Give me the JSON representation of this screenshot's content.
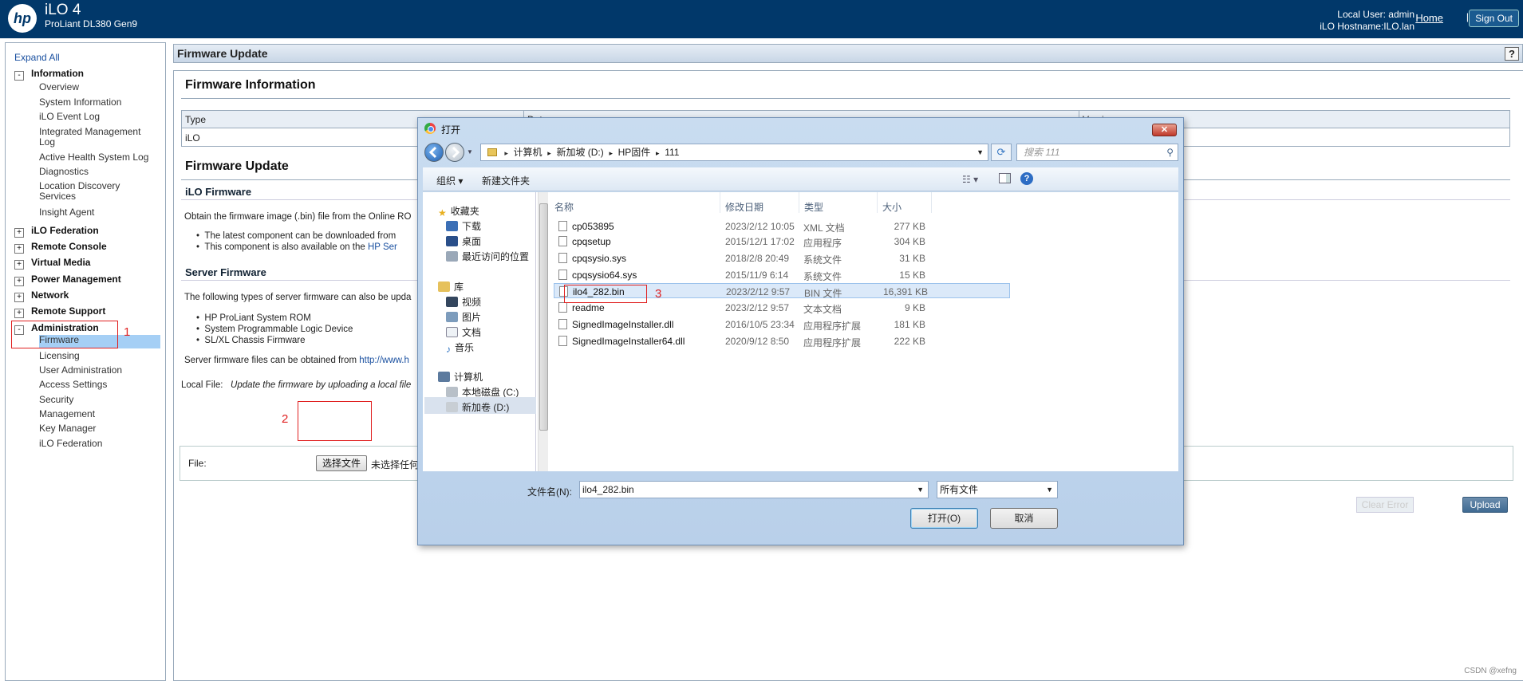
{
  "header": {
    "product": "iLO 4",
    "model": "ProLiant DL380 Gen9",
    "local_user": "Local User:  admin",
    "hostname": "iLO Hostname:ILO.lan",
    "home": "Home",
    "separator": "|",
    "sign_out": "Sign Out",
    "logo_text": "hp"
  },
  "nav": {
    "expand_all": "Expand All",
    "information": "Information",
    "info_items": [
      "Overview",
      "System Information",
      "iLO Event Log",
      "Integrated Management Log",
      "Active Health System Log",
      "Diagnostics",
      "Location Discovery Services",
      "Insight Agent"
    ],
    "groups": [
      "iLO Federation",
      "Remote Console",
      "Virtual Media",
      "Power Management",
      "Network",
      "Remote Support"
    ],
    "administration": "Administration",
    "admin_items": [
      "Firmware",
      "Licensing",
      "User Administration",
      "Access Settings",
      "Security",
      "Management",
      "Key Manager",
      "iLO Federation"
    ],
    "box_expanded": "-",
    "box_collapsed": "+"
  },
  "page": {
    "title": "Firmware Update",
    "help": "?",
    "fw_info_heading": "Firmware Information",
    "table_headers": [
      "Type",
      "Date",
      "Version"
    ],
    "table_row": [
      "iLO",
      "",
      ""
    ],
    "fw_update_heading": "Firmware Update",
    "ilo_fw_heading": "iLO Firmware",
    "ilo_fw_text": "Obtain the firmware image (.bin) file from the Online RO",
    "bullet1": "The latest component can be downloaded from",
    "bullet2": "This component is also available on the",
    "bullet2_link": "HP Ser",
    "server_fw_heading": "Server Firmware",
    "server_fw_text": "The following types of server firmware can also be upda",
    "server_items": [
      "HP ProLiant System ROM",
      "System Programmable Logic Device",
      "SL/XL Chassis Firmware"
    ],
    "obtained_text": "Server firmware files can be obtained from",
    "obtained_link": "http://www.h",
    "local_file_label": "Local File:",
    "local_file_desc": "Update the firmware by uploading a local file",
    "file_label": "File:",
    "choose_button": "选择文件",
    "no_file": "未选择任何",
    "clear_error": "Clear Error",
    "upload": "Upload"
  },
  "annotations": {
    "n1": "1",
    "n2": "2",
    "n3": "3"
  },
  "dialog": {
    "title": "打开",
    "close": "✕",
    "address": [
      "计算机",
      "新加坡 (D:)",
      "HP固件",
      "111"
    ],
    "address_sep": "▸",
    "search_placeholder": "搜索 111",
    "organize": "组织 ▾",
    "new_folder": "新建文件夹",
    "tree": {
      "favorites": "收藏夹",
      "fav_items": [
        "下载",
        "桌面",
        "最近访问的位置"
      ],
      "library": "库",
      "lib_items": [
        "视频",
        "图片",
        "文档",
        "音乐"
      ],
      "computer": "计算机",
      "drives": [
        "本地磁盘 (C:)",
        "新加卷 (D:)"
      ]
    },
    "columns": [
      "名称",
      "修改日期",
      "类型",
      "大小"
    ],
    "files": [
      {
        "name": "cp053895",
        "date": "2023/2/12 10:05",
        "type": "XML 文档",
        "size": "277 KB"
      },
      {
        "name": "cpqsetup",
        "date": "2015/12/1 17:02",
        "type": "应用程序",
        "size": "304 KB"
      },
      {
        "name": "cpqsysio.sys",
        "date": "2018/2/8 20:49",
        "type": "系统文件",
        "size": "31 KB"
      },
      {
        "name": "cpqsysio64.sys",
        "date": "2015/11/9 6:14",
        "type": "系统文件",
        "size": "15 KB"
      },
      {
        "name": "ilo4_282.bin",
        "date": "2023/2/12 9:57",
        "type": "BIN 文件",
        "size": "16,391 KB"
      },
      {
        "name": "readme",
        "date": "2023/2/12 9:57",
        "type": "文本文档",
        "size": "9 KB"
      },
      {
        "name": "SignedImageInstaller.dll",
        "date": "2016/10/5 23:34",
        "type": "应用程序扩展",
        "size": "181 KB"
      },
      {
        "name": "SignedImageInstaller64.dll",
        "date": "2020/9/12 8:50",
        "type": "应用程序扩展",
        "size": "222 KB"
      }
    ],
    "filename_label": "文件名(N):",
    "filename_value": "ilo4_282.bin",
    "filter": "所有文件",
    "open": "打开(O)",
    "cancel": "取消"
  },
  "watermark": "CSDN @xefng",
  "colors": {
    "header_bg": "#01386a",
    "annotation": "#e02020",
    "selection": "#a5cff5"
  }
}
